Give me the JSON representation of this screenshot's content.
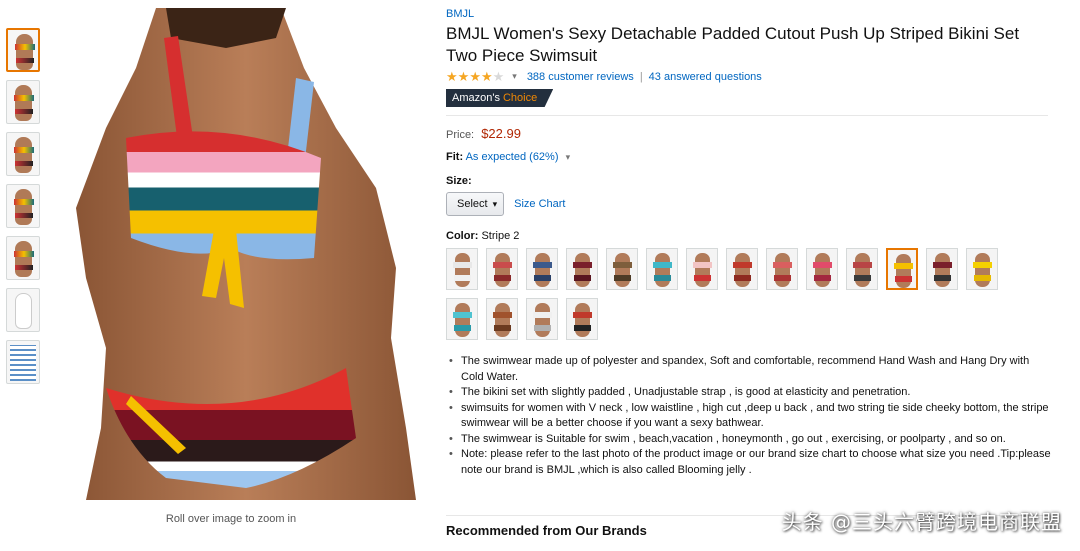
{
  "product": {
    "brand": "BMJL",
    "title": "BMJL Women's Sexy Detachable Padded Cutout Push Up Striped Bikini Set Two Piece Swimsuit",
    "rating": 4,
    "reviews_label": "388 customer reviews",
    "questions_label": "43 answered questions",
    "separator": "|",
    "badge_prefix": "Amazon's",
    "badge_choice": "Choice",
    "price_label": "Price:",
    "price": "$22.99",
    "fit_label": "Fit:",
    "fit_value": "As expected (62%)",
    "size_label": "Size:",
    "size_select": "Select",
    "size_chart": "Size Chart",
    "color_label": "Color:",
    "color_value": "Stripe 2",
    "zoom_hint": "Roll over image to zoom in"
  },
  "thumbnails": [
    {
      "style": "model",
      "active": true
    },
    {
      "style": "product"
    },
    {
      "style": "model"
    },
    {
      "style": "model"
    },
    {
      "style": "model"
    },
    {
      "style": "white"
    },
    {
      "style": "chart"
    }
  ],
  "swatches": [
    {
      "top": "#e8e8e8",
      "bottom": "#f0f0f0"
    },
    {
      "top": "#c94c4c",
      "bottom": "#8a2a2a"
    },
    {
      "top": "#3c5a8c",
      "bottom": "#2a3f66"
    },
    {
      "top": "#7a1f2b",
      "bottom": "#5a1620"
    },
    {
      "top": "#7e5e3c",
      "bottom": "#4e3b26"
    },
    {
      "top": "#3fb8c8",
      "bottom": "#2a8a98"
    },
    {
      "top": "#f2c4c4",
      "bottom": "#c33"
    },
    {
      "top": "#c0392b",
      "bottom": "#8e2a20"
    },
    {
      "top": "#d95f5f",
      "bottom": "#a33"
    },
    {
      "top": "#e14b6a",
      "bottom": "#a3283f"
    },
    {
      "top": "#b84545",
      "bottom": "#3a3a3a"
    },
    {
      "top": "#f5c000",
      "bottom": "#c33",
      "active": true
    },
    {
      "top": "#7a1f2b",
      "bottom": "#333"
    },
    {
      "top": "#f5d000",
      "bottom": "#e6b800"
    },
    {
      "top": "#4fc3d0",
      "bottom": "#2a9aa8"
    },
    {
      "top": "#a0522d",
      "bottom": "#6b3a20"
    },
    {
      "top": "#f0f0f0",
      "bottom": "#b0b0b0"
    },
    {
      "top": "#c0392b",
      "bottom": "#222"
    }
  ],
  "bullets": [
    "The swimwear made up of polyester and spandex, Soft and comfortable, recommend Hand Wash and Hang Dry with Cold Water.",
    "The bikini set with slightly padded , Unadjustable strap , is good at elasticity and penetration.",
    "swimsuits for women with V neck , low waistline , high cut ,deep u back , and two string tie side cheeky bottom, the stripe swimwear will be a better choose if you want a sexy bathwear.",
    "The swimwear is Suitable for swim , beach,vacation , honeymonth , go out , exercising, or poolparty , and so on.",
    "Note: please refer to the last photo of the product image or our brand size chart to choose what size you need .Tip:please note our brand is BMJL ,which is also called Blooming jelly ."
  ],
  "recommended_heading": "Recommended from Our Brands",
  "watermark": "头条 @三头六臂跨境电商联盟",
  "colors": {
    "link": "#0066c0",
    "price": "#b12704",
    "star": "#f5a623",
    "badge_bg": "#232f3e",
    "badge_accent": "#f08804",
    "active_border": "#e77600"
  },
  "icons": {
    "star": "star-icon",
    "chevron": "chevron-down-icon"
  }
}
